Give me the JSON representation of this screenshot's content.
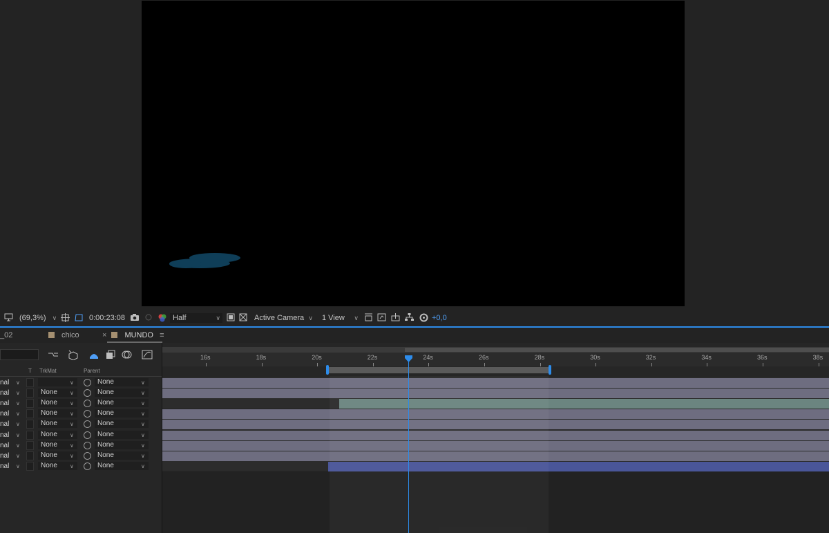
{
  "viewer": {
    "zoom": "(69,3%)",
    "timecode": "0:00:23:08",
    "resolution": "Half",
    "camera": "Active Camera",
    "views": "1 View",
    "exposure": "+0,0"
  },
  "tabs": [
    {
      "label": "_02"
    },
    {
      "label": "chico"
    },
    {
      "label": "MUNDO",
      "close": "×",
      "menu": "≡"
    }
  ],
  "columns": {
    "t": "T",
    "trkmat": "TrkMat",
    "parent": "Parent"
  },
  "layers": [
    {
      "mode": "nal",
      "trkmat": "",
      "parent": "None"
    },
    {
      "mode": "nal",
      "trkmat": "None",
      "parent": "None"
    },
    {
      "mode": "nal",
      "trkmat": "None",
      "parent": "None"
    },
    {
      "mode": "nal",
      "trkmat": "None",
      "parent": "None"
    },
    {
      "mode": "nal",
      "trkmat": "None",
      "parent": "None"
    },
    {
      "mode": "nal",
      "trkmat": "None",
      "parent": "None"
    },
    {
      "mode": "nal",
      "trkmat": "None",
      "parent": "None"
    },
    {
      "mode": "nal",
      "trkmat": "None",
      "parent": "None"
    },
    {
      "mode": "nal",
      "trkmat": "None",
      "parent": "None"
    }
  ],
  "ruler": [
    "16s",
    "18s",
    "20s",
    "22s",
    "24s",
    "26s",
    "28s",
    "30s",
    "32s",
    "34s",
    "36s",
    "38s"
  ],
  "colors": {
    "accent": "#2d8ceb",
    "bar_gray": "#6e6d80",
    "bar_green": "#6b8580",
    "bar_blue": "#4a5699",
    "label": "#a59071"
  },
  "icons": [
    "monitor-icon",
    "grid-icon",
    "mask-icon",
    "camera-snapshot-icon",
    "show-snapshot-icon",
    "color-channel-icon",
    "transparency-grid-icon",
    "region-of-interest-icon",
    "3d-view-icon",
    "fast-preview-icon",
    "flowchart-icon",
    "reset-exposure-icon",
    "comp-flow-icon",
    "draft-3d-icon",
    "shy-icon",
    "frame-blend-icon",
    "motion-blur-icon",
    "graph-editor-icon"
  ]
}
